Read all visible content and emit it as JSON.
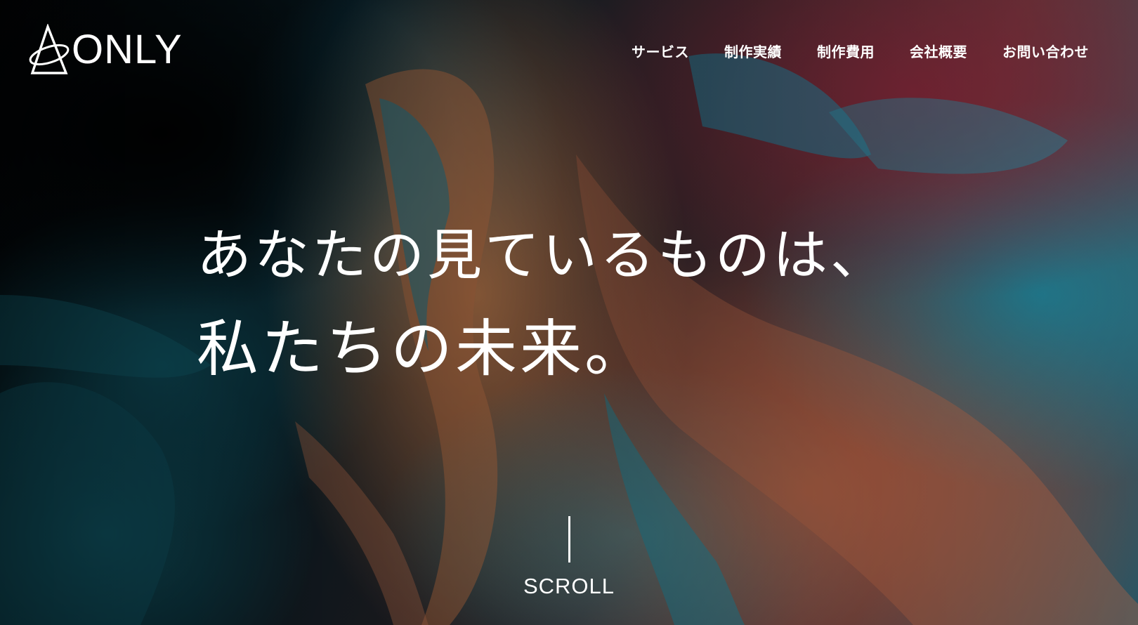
{
  "brand": {
    "name": "ONLY",
    "icon": "triangle-ring-logo-icon"
  },
  "nav": {
    "items": [
      {
        "label": "サービス"
      },
      {
        "label": "制作実績"
      },
      {
        "label": "制作費用"
      },
      {
        "label": "会社概要"
      },
      {
        "label": "お問い合わせ"
      }
    ]
  },
  "hero": {
    "line1": "あなたの見ているものは、",
    "line2": "私たちの未来。",
    "scroll_label": "SCROLL"
  },
  "colors": {
    "text": "#ffffff",
    "accent_orange": "#d98c5a",
    "accent_teal": "#1c93ad",
    "accent_red": "#8c283c"
  }
}
